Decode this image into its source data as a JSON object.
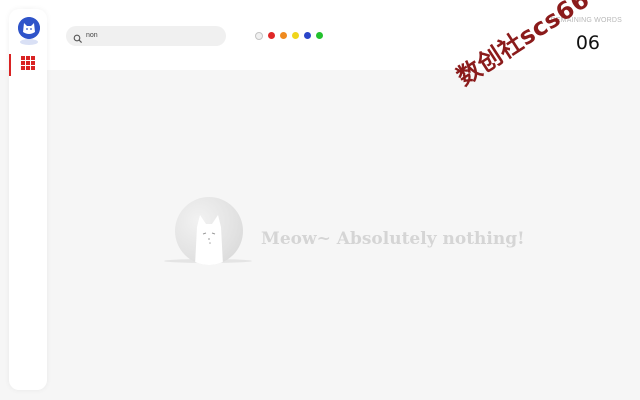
{
  "search": {
    "value": "non"
  },
  "color_filters": [
    {
      "name": "grey-outline",
      "color": "#f0f0f0"
    },
    {
      "name": "red",
      "color": "#e02727"
    },
    {
      "name": "orange",
      "color": "#ef8a1f"
    },
    {
      "name": "yellow",
      "color": "#f0d51c"
    },
    {
      "name": "blue",
      "color": "#2a45c9"
    },
    {
      "name": "green",
      "color": "#23c12d"
    }
  ],
  "remaining": {
    "label": "REMAINING WORDS",
    "count": "06"
  },
  "watermark": {
    "text": "数创社scs66"
  },
  "empty_state": {
    "message": "Meow~ Absolutely nothing!"
  },
  "sidebar": {
    "items": [
      {
        "icon": "grid-icon",
        "active": true
      }
    ]
  },
  "colors": {
    "accent": "#d92323",
    "brand": "#2f54c9"
  }
}
